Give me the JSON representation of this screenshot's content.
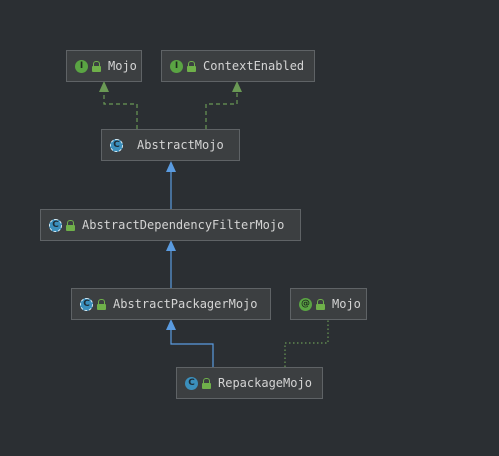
{
  "colors": {
    "background": "#2b2f33",
    "node_fill": "#3c3f41",
    "node_border": "#5f6366",
    "text": "#d4d4d4",
    "interface_badge": "#5aa443",
    "class_badge": "#3b8fbc",
    "implements_edge": "#6a9955",
    "extends_edge": "#5a9be0"
  },
  "nodes": {
    "mojo_interface": {
      "badge": "I",
      "label": "Mojo"
    },
    "context_enabled": {
      "badge": "I",
      "label": "ContextEnabled"
    },
    "abstract_mojo": {
      "badge": "C",
      "label": "AbstractMojo"
    },
    "abstract_dependency_filter_mojo": {
      "badge": "C",
      "label": "AbstractDependencyFilterMojo"
    },
    "abstract_packager_mojo": {
      "badge": "C",
      "label": "AbstractPackagerMojo"
    },
    "mojo_annotation": {
      "badge": "@",
      "label": "Mojo"
    },
    "repackage_mojo": {
      "badge": "C",
      "label": "RepackageMojo"
    }
  }
}
